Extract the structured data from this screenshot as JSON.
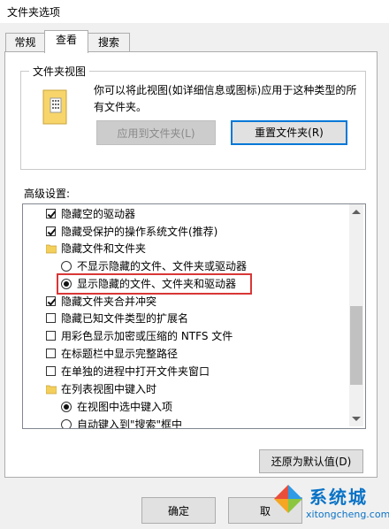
{
  "window": {
    "title": "文件夹选项"
  },
  "tabs": [
    {
      "label": "常规"
    },
    {
      "label": "查看"
    },
    {
      "label": "搜索"
    }
  ],
  "folder_views": {
    "group_label": "文件夹视图",
    "description": "你可以将此视图(如详细信息或图标)应用于这种类型的所有文件夹。",
    "apply_button": "应用到文件夹(L)",
    "reset_button": "重置文件夹(R)"
  },
  "advanced": {
    "label": "高级设置:",
    "items": [
      {
        "kind": "checkbox",
        "checked": true,
        "label": "隐藏空的驱动器"
      },
      {
        "kind": "checkbox",
        "checked": true,
        "label": "隐藏受保护的操作系统文件(推荐)"
      },
      {
        "kind": "folder",
        "label": "隐藏文件和文件夹"
      },
      {
        "kind": "radio",
        "selected": false,
        "label": "不显示隐藏的文件、文件夹或驱动器"
      },
      {
        "kind": "radio",
        "selected": true,
        "label": "显示隐藏的文件、文件夹和驱动器"
      },
      {
        "kind": "checkbox",
        "checked": true,
        "label": "隐藏文件夹合并冲突"
      },
      {
        "kind": "checkbox",
        "checked": false,
        "label": "隐藏已知文件类型的扩展名"
      },
      {
        "kind": "checkbox",
        "checked": false,
        "label": "用彩色显示加密或压缩的 NTFS 文件"
      },
      {
        "kind": "checkbox",
        "checked": false,
        "label": "在标题栏中显示完整路径"
      },
      {
        "kind": "checkbox",
        "checked": false,
        "label": "在单独的进程中打开文件夹窗口"
      },
      {
        "kind": "folder",
        "label": "在列表视图中键入时"
      },
      {
        "kind": "radio",
        "selected": true,
        "label": "在视图中选中键入项"
      },
      {
        "kind": "radio",
        "selected": false,
        "label": "自动键入到\"搜索\"框中"
      }
    ],
    "restore_button": "还原为默认值(D)"
  },
  "footer": {
    "ok_button": "确定",
    "cancel_button": "取"
  },
  "watermark": {
    "name": "系统城",
    "url": "xitongcheng.com",
    "logo_colors": [
      "#2e9be6",
      "#8cc63f",
      "#f5a623",
      "#e94e3c"
    ]
  }
}
